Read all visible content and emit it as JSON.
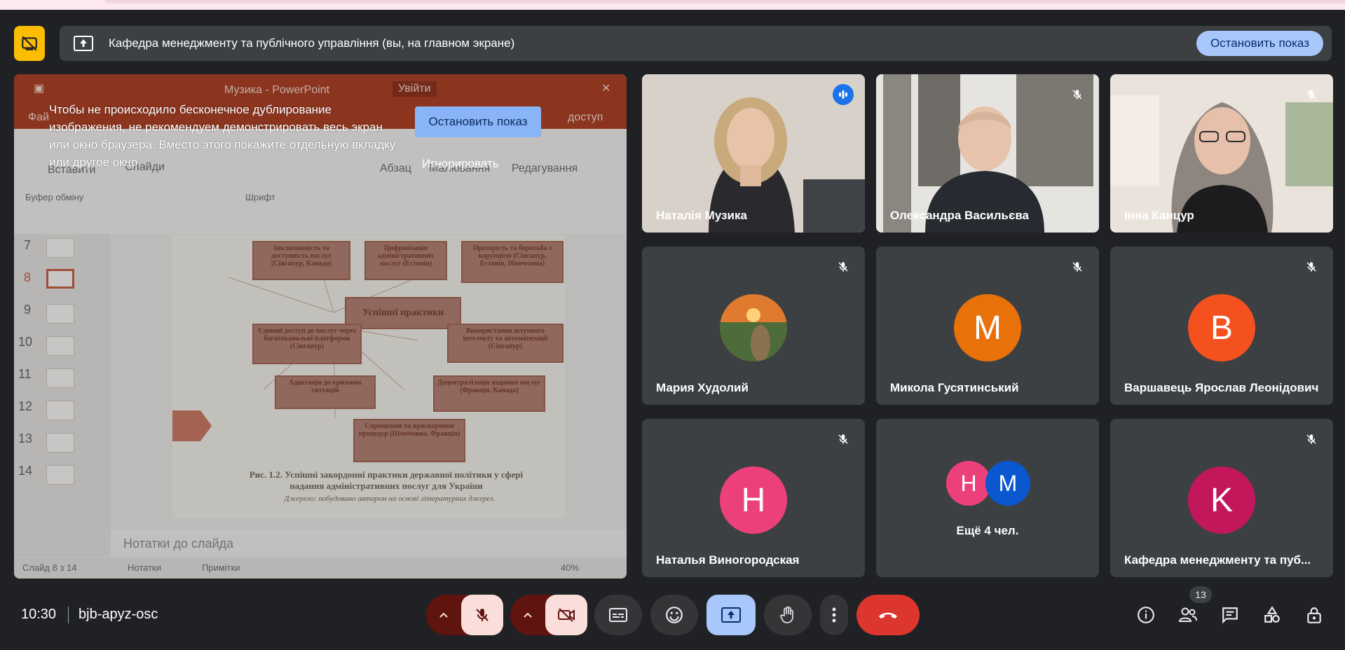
{
  "presentation": {
    "title": "Кафедра менеджменту та публічного управління (вы, на главном экране)",
    "stop_label": "Остановить показ"
  },
  "shared_screen": {
    "ppt": {
      "window_title": "Музика  -  PowerPoint",
      "signin": "Увійти",
      "file_tab": "Фай",
      "access": "доступ",
      "paste": "Вставити",
      "slides": "Слайди",
      "paragraph": "Абзац",
      "drawing": "Малювання",
      "editing": "Редагування",
      "clipboard": "Буфер обміну",
      "font": "Шрифт",
      "slide_numbers": [
        "7",
        "8",
        "9",
        "10",
        "11",
        "12",
        "13",
        "14"
      ],
      "notes_placeholder": "Нотатки до слайда",
      "status_slide": "Слайд 8 з 14",
      "status_notes": "Нотатки",
      "status_comments": "Примітки",
      "zoom": "40%",
      "boxes": {
        "b1": "Інклюзивність та доступність послуг (Сінгапур, Канада)",
        "b2": "Цифровізація адміністративних послуг (Естонія)",
        "b3": "Прозорість та боротьба з корупцією (Сінгапур, Естонія, Німеччина)",
        "center": "Успішні практики",
        "b4": "Єдиний доступ до послуг через багатоканальні платформи (Сінгапур)",
        "b5": "Використання штучного інтелекту та автоматизації (Сінгапур)",
        "b6": "Адаптація до кризових ситуацій",
        "b7": "Децентралізація надання послуг (Франція, Канада)",
        "b8": "Спрощення та прискорення процедур (Німеччина, Франція)"
      },
      "caption": "Рис. 1.2. Успішні закордонні практики державної політики у сфері надання адміністративних послуг для України",
      "source": "Джерело: побудовано автором на основі літературних джерел."
    },
    "warning": {
      "text": "Чтобы не происходило бесконечное дублирование изображения, не рекомендуем демонстрировать весь экран или окно браузера. Вместо этого покажите отдельную вкладку или другое окно.",
      "stop_label": "Остановить показ",
      "ignore_label": "Игнорировать"
    }
  },
  "participants": [
    {
      "name": "Наталія Музика",
      "type": "video",
      "mic": "speaking"
    },
    {
      "name": "Олександра Васильєва",
      "type": "video",
      "mic": "muted"
    },
    {
      "name": "Інна Канцур",
      "type": "video",
      "mic": "muted"
    },
    {
      "name": "Мария Худолий",
      "type": "photo",
      "mic": "muted"
    },
    {
      "name": "Микола Гусятинський",
      "type": "avatar",
      "initial": "M",
      "color": "#e8710a",
      "mic": "muted"
    },
    {
      "name": "Варшавець Ярослав Леонідович",
      "type": "avatar",
      "initial": "B",
      "color": "#f4511e",
      "mic": "muted"
    },
    {
      "name": "Наталья Виногородская",
      "type": "avatar",
      "initial": "Н",
      "color": "#ec407a",
      "mic": "muted"
    },
    {
      "more_label": "Ещё 4 чел.",
      "initials": [
        "Н",
        "M"
      ],
      "colors": [
        "#ec407a",
        "#0b57d0"
      ]
    },
    {
      "name": "Кафедра менеджменту та пуб...",
      "type": "avatar",
      "initial": "K",
      "color": "#c2185b",
      "mic": "muted"
    }
  ],
  "bottom_bar": {
    "time": "10:30",
    "meeting_code": "bjb-apyz-osc",
    "participants_count": "13"
  },
  "icons": [
    "camera-off-icon",
    "present-screen-icon",
    "mic-off-icon",
    "cam-off-icon",
    "captions-icon",
    "emoji-icon",
    "present-icon",
    "hand-icon",
    "more-icon",
    "hangup-icon",
    "info-icon",
    "people-icon",
    "chat-icon",
    "activities-icon",
    "host-controls-icon"
  ],
  "colors": {
    "background": "#202124",
    "tile": "#3c4043",
    "accent": "#8ab4f8",
    "hangup": "#ea4335",
    "warning": "#fbbc04"
  }
}
